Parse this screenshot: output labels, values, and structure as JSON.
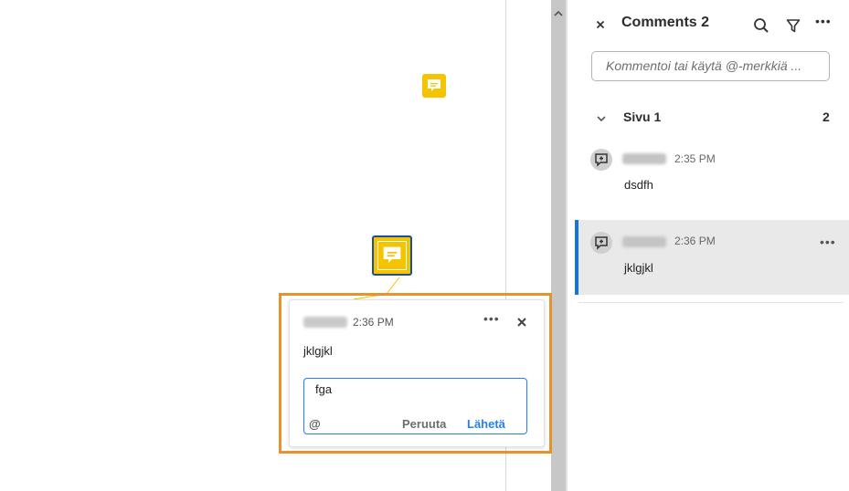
{
  "document": {
    "popup": {
      "time": "2:36 PM",
      "comment_text": "jklgjkl",
      "reply_value": "fga",
      "at_symbol": "@",
      "cancel_label": "Peruuta",
      "send_label": "Lähetä"
    }
  },
  "panel": {
    "title": "Comments 2",
    "input_placeholder": "Kommentoi tai käytä @-merkkiä ...",
    "section": {
      "title": "Sivu 1",
      "count": "2"
    },
    "comments": [
      {
        "time": "2:35 PM",
        "text": "dsdfh"
      },
      {
        "time": "2:36 PM",
        "text": "jklgjkl"
      }
    ]
  },
  "colors": {
    "accent": "#2680eb",
    "selection_outline": "#e8912d",
    "note_yellow": "#f5c400",
    "selected_bar": "#1473e6"
  },
  "icons": [
    "close-icon",
    "search-icon",
    "filter-icon",
    "more-icon",
    "chevron-down-icon",
    "comment-avatar-icon",
    "sticky-note-icon"
  ]
}
